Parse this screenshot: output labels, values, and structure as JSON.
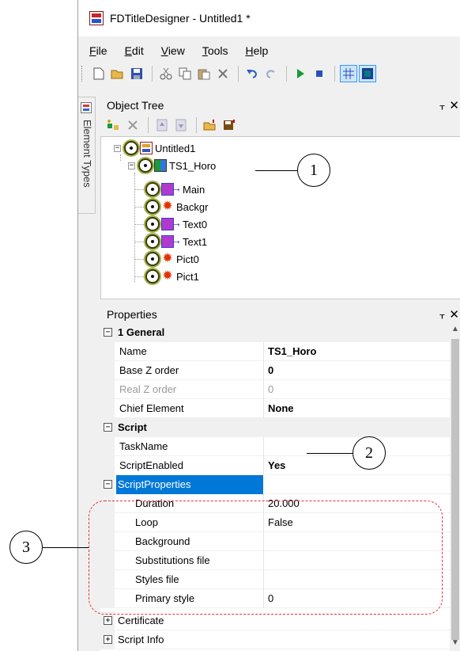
{
  "window": {
    "title": "FDTitleDesigner - Untitled1 *"
  },
  "menu": [
    {
      "accel": "F",
      "rest": "ile"
    },
    {
      "accel": "E",
      "rest": "dit"
    },
    {
      "accel": "V",
      "rest": "iew"
    },
    {
      "accel": "T",
      "rest": "ools"
    },
    {
      "accel": "H",
      "rest": "elp"
    }
  ],
  "toolbar": {
    "icons": [
      "new-icon",
      "open-icon",
      "save-icon",
      "cut-icon",
      "copy-icon",
      "paste-icon",
      "delete-icon",
      "undo-icon",
      "redo-icon",
      "play-icon",
      "stop-icon",
      "grid-icon",
      "preview-icon"
    ]
  },
  "side_tab": {
    "label": "Element Types"
  },
  "object_tree": {
    "header": "Object Tree",
    "pin": "ᚁ",
    "close": "✕",
    "toolbar_icons": [
      "add-element-icon",
      "delete-icon",
      "move-up-icon",
      "move-down-icon",
      "load-icon",
      "save-icon"
    ],
    "nodes": [
      {
        "label": "Untitled1",
        "icon": "root-icon"
      },
      {
        "label": "TS1_Horo",
        "icon": "horo-icon"
      },
      {
        "label": "Main",
        "icon": "text-element-icon"
      },
      {
        "label": "Backgr",
        "icon": "picture-element-icon"
      },
      {
        "label": "Text0",
        "icon": "text-element-icon"
      },
      {
        "label": "Text1",
        "icon": "text-element-icon"
      },
      {
        "label": "Pict0",
        "icon": "picture-element-icon"
      },
      {
        "label": "Pict1",
        "icon": "picture-element-icon"
      }
    ]
  },
  "properties": {
    "header": "Properties",
    "pin": "ᚁ",
    "close": "✕",
    "rows": [
      {
        "type": "category",
        "expander": "−",
        "name": "1 General",
        "value": ""
      },
      {
        "type": "prop",
        "name": "Name",
        "value": "TS1_Horo",
        "style": "bold"
      },
      {
        "type": "prop",
        "name": "Base Z order",
        "value": "0",
        "style": "bold"
      },
      {
        "type": "prop",
        "name": "Real Z order",
        "value": "0",
        "style": "gray"
      },
      {
        "type": "prop",
        "name": "Chief Element",
        "value": "None",
        "style": "bold"
      },
      {
        "type": "category",
        "expander": "−",
        "name": "Script",
        "value": ""
      },
      {
        "type": "prop",
        "name": "TaskName",
        "value": "",
        "style": ""
      },
      {
        "type": "prop",
        "name": "ScriptEnabled",
        "value": "Yes",
        "style": "bold"
      },
      {
        "type": "subcat",
        "expander": "−",
        "name": "ScriptProperties",
        "value": ""
      },
      {
        "type": "sub",
        "name": "Duration",
        "value": "20.000",
        "style": ""
      },
      {
        "type": "sub",
        "name": "Loop",
        "value": "False",
        "style": ""
      },
      {
        "type": "sub",
        "name": "Background",
        "value": "",
        "style": ""
      },
      {
        "type": "sub",
        "name": "Substitutions file",
        "value": "",
        "style": ""
      },
      {
        "type": "sub",
        "name": "Styles file",
        "value": "",
        "style": ""
      },
      {
        "type": "sub",
        "name": "Primary style",
        "value": "0",
        "style": ""
      },
      {
        "type": "collapsed",
        "expander": "+",
        "name": "Certificate",
        "value": ""
      },
      {
        "type": "collapsed",
        "expander": "+",
        "name": "Script Info",
        "value": ""
      }
    ]
  },
  "callouts": [
    "1",
    "2",
    "3"
  ],
  "colors": {
    "selection": "#0078d7",
    "highlight_box": "#e8303a"
  }
}
